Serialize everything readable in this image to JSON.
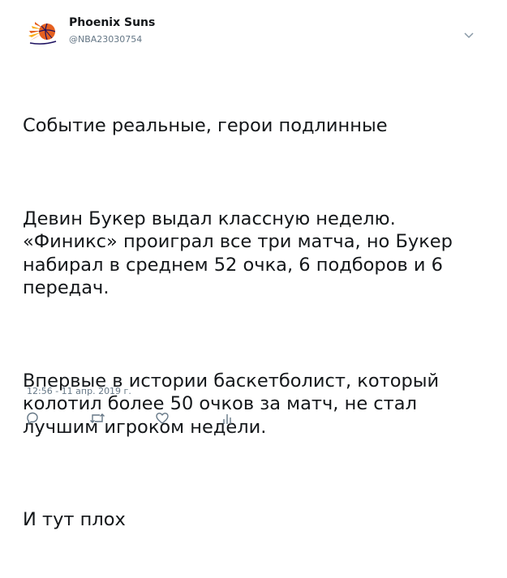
{
  "tweet": {
    "display_name": "Phoenix Suns",
    "handle": "@NBA23030754",
    "paragraphs": [
      "Событие реальные, герои подлинные",
      "Девин Букер выдал классную неделю. «Финикс» проиграл все три матча, но Букер набирал в среднем 52 очка, 6 подборов и 6 передач.",
      "Впервые в истории баскетболист, который колотил более 50 очков за матч, не стал лучшим игроком недели.",
      "И тут плох"
    ],
    "timestamp": "12:56 - 11 апр. 2019 г."
  },
  "icons": {
    "avatar": "phoenix-suns-logo",
    "menu": "chevron-down-icon",
    "reply": "reply-icon",
    "retweet": "retweet-icon",
    "like": "like-icon",
    "analytics": "analytics-icon"
  },
  "colors": {
    "text": "#14171a",
    "secondary": "#657786",
    "icon": "#657786",
    "avatar_orange": "#e56020",
    "avatar_purple": "#1d1160"
  }
}
